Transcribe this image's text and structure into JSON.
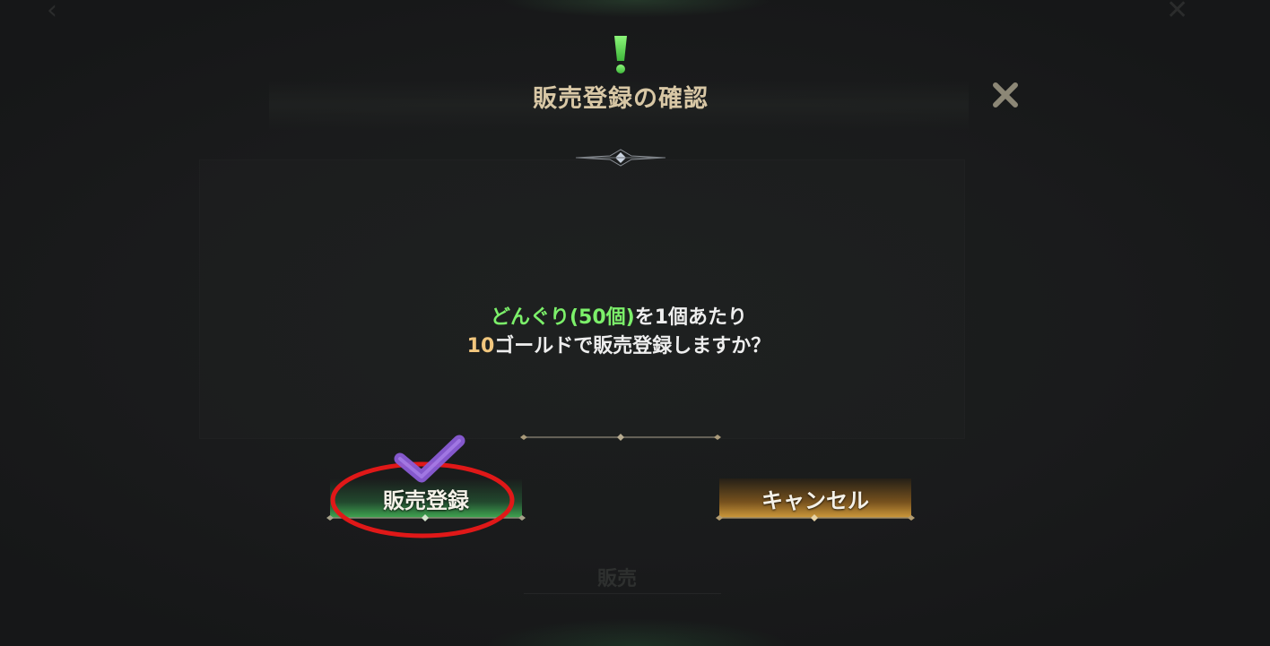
{
  "dialog": {
    "title": "販売登録の確認",
    "message_line1": {
      "item": "どんぐり",
      "open_paren": "(",
      "quantity": "50個",
      "close_paren": ")",
      "suffix": "を1個あたり"
    },
    "message_line2": {
      "price": "10",
      "suffix": "ゴールドで販売登録しますか？"
    }
  },
  "buttons": {
    "register_label": "販売登録",
    "cancel_label": "キャンセル"
  },
  "background": {
    "sell_tab_label": "販売"
  },
  "icons": {
    "alert": "exclamation-icon",
    "close": "close-icon",
    "check_annotation": "checkmark-icon"
  },
  "colors": {
    "title": "#d8c7a5",
    "highlight_green": "#7cf06a",
    "highlight_gold": "#f2c77e",
    "register_button": "#46be5a",
    "cancel_button": "#d7a03c",
    "annotation_red": "#e01818",
    "annotation_purple": "#8a5cd6"
  }
}
